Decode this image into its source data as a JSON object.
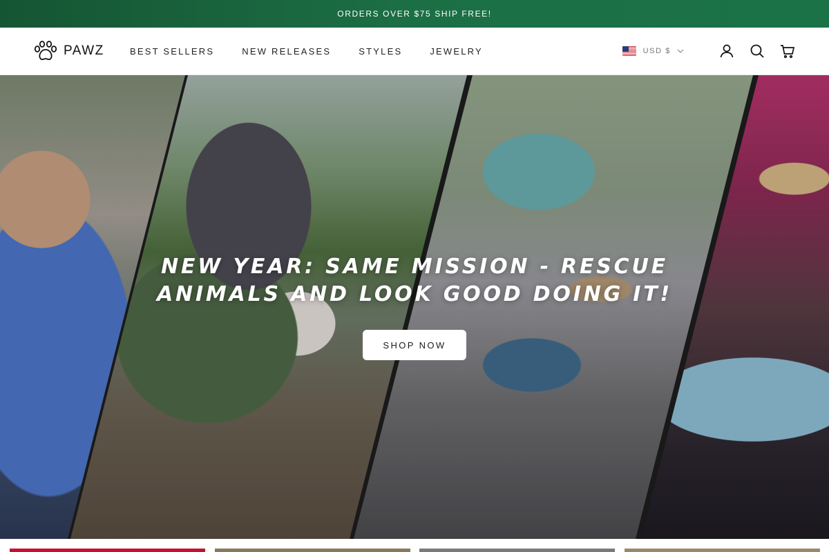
{
  "announcement": {
    "text": "ORDERS OVER $75 SHIP FREE!"
  },
  "header": {
    "logo_text": "PAWZ",
    "logo_icon": "paw-icon",
    "nav": [
      {
        "label": "BEST SELLERS"
      },
      {
        "label": "NEW RELEASES"
      },
      {
        "label": "STYLES"
      },
      {
        "label": "JEWELRY"
      }
    ],
    "currency": {
      "label": "USD $",
      "flag": "us-flag-icon"
    },
    "icons": [
      "account-icon",
      "search-icon",
      "cart-icon"
    ]
  },
  "hero": {
    "title": "NEW YEAR: SAME MISSION - RESCUE ANIMALS AND LOOK GOOD DOING IT!",
    "button_label": "SHOP NOW"
  },
  "colors": {
    "announcement_bg": "#1c6f45",
    "tile_colors": [
      "#c8102e",
      "#8a7a5c",
      "#7a7a7a",
      "#9a8a6a"
    ]
  }
}
